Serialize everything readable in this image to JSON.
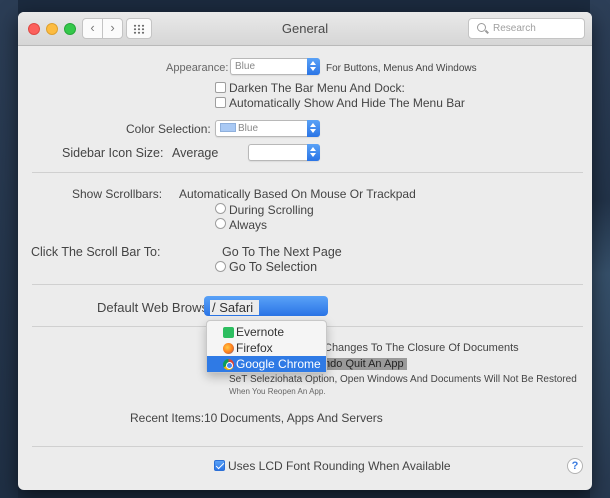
{
  "window": {
    "title": "General",
    "search_placeholder": "Research"
  },
  "appearance": {
    "label": "Appearance:",
    "value": "Blue",
    "note": "For Buttons, Menus And Windows"
  },
  "dark_menu": {
    "label": "Darken The Bar Menu And Dock:",
    "checked": false
  },
  "auto_menubar": {
    "label": "Automatically Show And Hide The Menu Bar",
    "checked": false
  },
  "color_selection": {
    "label": "Color Selection:",
    "value": "Blue",
    "swatch_color": "#a9c9f4"
  },
  "sidebar_icon": {
    "label": "Sidebar Icon Size:",
    "value": "Average"
  },
  "scrollbars": {
    "label": "Show Scrollbars:",
    "options": [
      "Automatically Based On Mouse Or Trackpad",
      "During Scrolling",
      "Always"
    ]
  },
  "click_scroll": {
    "label": "Click The Scroll Bar To:",
    "options": [
      "Go To The Next Page",
      "Go To Selection"
    ]
  },
  "default_browser": {
    "label": "Default Web Browser",
    "value": "Safari",
    "menu": [
      "Evernote",
      "Firefox",
      "Google Chrome"
    ],
    "selected": "Google Chrome"
  },
  "documents": {
    "line1": "Changes To The Closure Of Documents",
    "line2": "Indo Quit An App",
    "line3": "SeT Seleziohata Option, Open Windows And Documents Will Not Be Restored",
    "line4": "When You Reopen An App."
  },
  "recent_items": {
    "label": "Recent Items:",
    "value": "10",
    "note": "Documents, Apps And Servers"
  },
  "lcd_font": {
    "label": "Uses LCD Font Rounding When Available",
    "checked": true
  },
  "help_label": "?",
  "accent_color": "#2f7ae5"
}
